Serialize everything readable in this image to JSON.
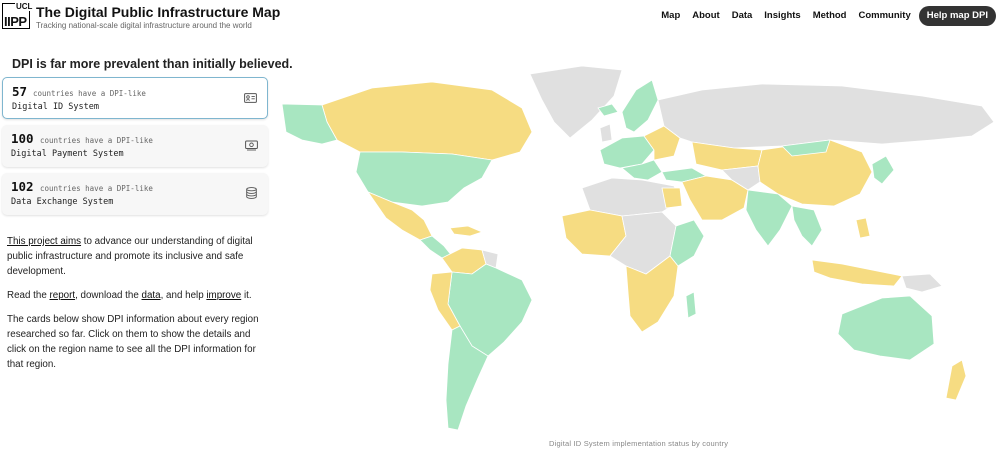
{
  "header": {
    "logo_top": "UCL",
    "logo_main": "IIPP",
    "title": "The Digital Public Infrastructure Map",
    "subtitle": "Tracking national-scale digital infrastructure around the world",
    "nav": [
      "Map",
      "About",
      "Data",
      "Insights",
      "Method",
      "Community"
    ],
    "cta": "Help map DPI"
  },
  "headline": "DPI is far more prevalent than initially believed.",
  "cards": [
    {
      "count": "57",
      "prefix": "countries have a DPI-like",
      "system": "Digital ID System",
      "icon": "id-card-icon",
      "active": true
    },
    {
      "count": "100",
      "prefix": "countries have a DPI-like",
      "system": "Digital Payment System",
      "icon": "payment-icon",
      "active": false
    },
    {
      "count": "102",
      "prefix": "countries have a DPI-like",
      "system": "Data Exchange System",
      "icon": "database-icon",
      "active": false
    }
  ],
  "intro": {
    "link": "This project aims",
    "text": " to advance our understanding of digital public infrastructure and promote its inclusive and safe development."
  },
  "read": {
    "t1": "Read the ",
    "report": "report",
    "t2": ", download the ",
    "data": "data",
    "t3": ", and help ",
    "improve": "improve",
    "t4": " it."
  },
  "cards_help": "The cards below show DPI information about every region researched so far. Click on them to show the details and click on the region name to see all the DPI information for that region.",
  "map": {
    "colors": {
      "implemented": "#a8e6c1",
      "in_progress": "#f6dc82",
      "none": "#e0e0e0"
    }
  },
  "caption": "Digital ID System implementation status by country"
}
